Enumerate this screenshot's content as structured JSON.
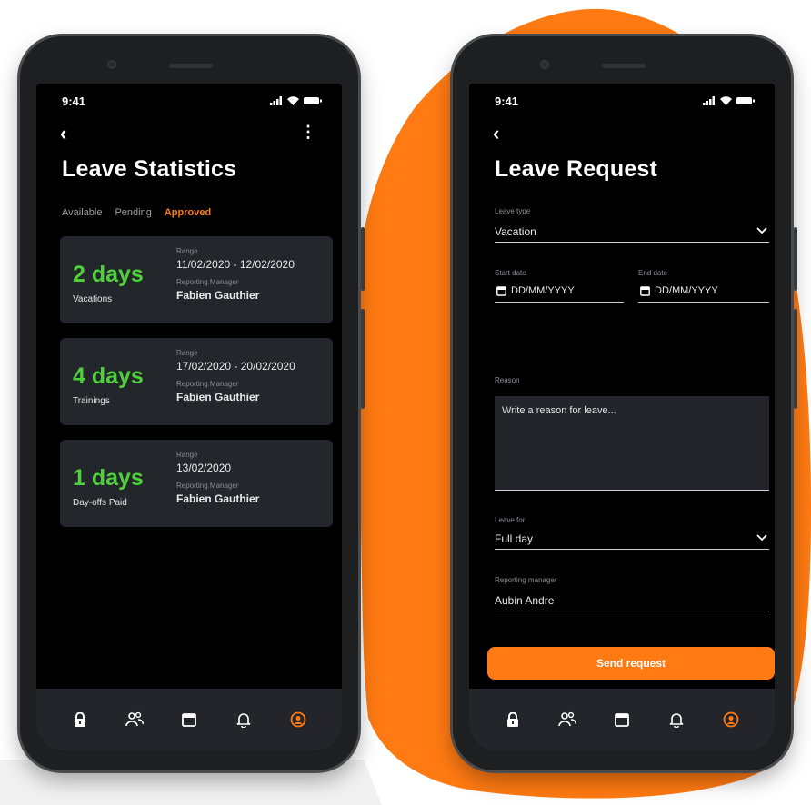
{
  "background": {
    "accent": "#ff7a12"
  },
  "colors": {
    "days_green": "#4fd13b",
    "card_bg": "#23262b",
    "screen_bg": "#000000"
  },
  "statistics_screen": {
    "status_time": "9:41",
    "title": "Leave Statistics",
    "tabs": [
      {
        "label": "Available",
        "active": false
      },
      {
        "label": "Pending",
        "active": false
      },
      {
        "label": "Approved",
        "active": true
      }
    ],
    "cards": [
      {
        "days": "2 days",
        "type": "Vacations",
        "range_label": "Range",
        "range": "11/02/2020 - 12/02/2020",
        "manager_label": "Reporting Manager",
        "manager": "Fabien Gauthier"
      },
      {
        "days": "4 days",
        "type": "Trainings",
        "range_label": "Range",
        "range": "17/02/2020 - 20/02/2020",
        "manager_label": "Reporting Manager",
        "manager": "Fabien Gauthier"
      },
      {
        "days": "1 days",
        "type": "Day-offs Paid",
        "range_label": "Range",
        "range": "13/02/2020",
        "manager_label": "Reporting Manager",
        "manager": "Fabien Gauthier"
      }
    ],
    "nav": [
      "lock-icon",
      "users-icon",
      "calendar-icon",
      "bell-icon",
      "profile-icon"
    ]
  },
  "request_screen": {
    "status_time": "9:41",
    "title": "Leave Request",
    "leave_type_label": "Leave type",
    "leave_type_value": "Vacation",
    "start_date_label": "Start date",
    "start_date_placeholder": "DD/MM/YYYY",
    "end_date_label": "End date",
    "end_date_placeholder": "DD/MM/YYYY",
    "reason_label": "Reason",
    "reason_placeholder": "Write a reason for leave...",
    "leave_for_label": "Leave for",
    "leave_for_value": "Full day",
    "manager_label": "Reporting manager",
    "manager_value": "Aubin Andre",
    "send_label": "Send request",
    "nav": [
      "lock-icon",
      "users-icon",
      "calendar-icon",
      "bell-icon",
      "profile-icon"
    ]
  }
}
